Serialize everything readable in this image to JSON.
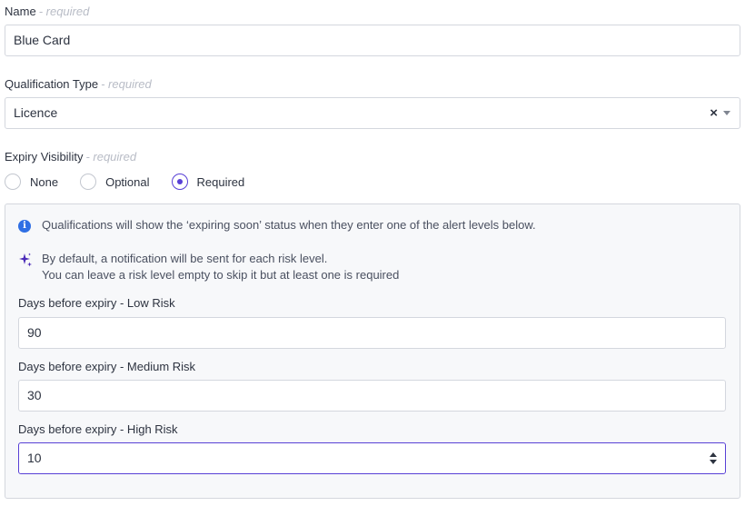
{
  "name": {
    "label": "Name",
    "required_hint": "- required",
    "value": "Blue Card"
  },
  "qualification_type": {
    "label": "Qualification Type",
    "required_hint": "- required",
    "value": "Licence",
    "clear_glyph": "×"
  },
  "expiry_visibility": {
    "label": "Expiry Visibility",
    "required_hint": "- required",
    "options": [
      {
        "label": "None",
        "checked": false
      },
      {
        "label": "Optional",
        "checked": false
      },
      {
        "label": "Required",
        "checked": true
      }
    ]
  },
  "alert_panel": {
    "info_icon_glyph": "i",
    "info_text": "Qualifications will show the ‘expiring soon’ status when they enter one of the alert levels below.",
    "notification_line1": "By default, a notification will be sent for each risk level.",
    "notification_line2": "You can leave a risk level empty to skip it but at least one is required",
    "low": {
      "label": "Days before expiry - Low Risk",
      "value": "90"
    },
    "medium": {
      "label": "Days before expiry - Medium Risk",
      "value": "30"
    },
    "high": {
      "label": "Days before expiry - High Risk",
      "value": "10"
    }
  },
  "colors": {
    "accent": "#5840d6",
    "info": "#2f6fe4",
    "border": "#d4d7de",
    "panel_bg": "#f7f8fa"
  },
  "icons": {
    "info": "info-icon",
    "sparkle": "sparkle-icon",
    "clear": "clear-icon",
    "dropdown": "chevron-down-icon"
  }
}
